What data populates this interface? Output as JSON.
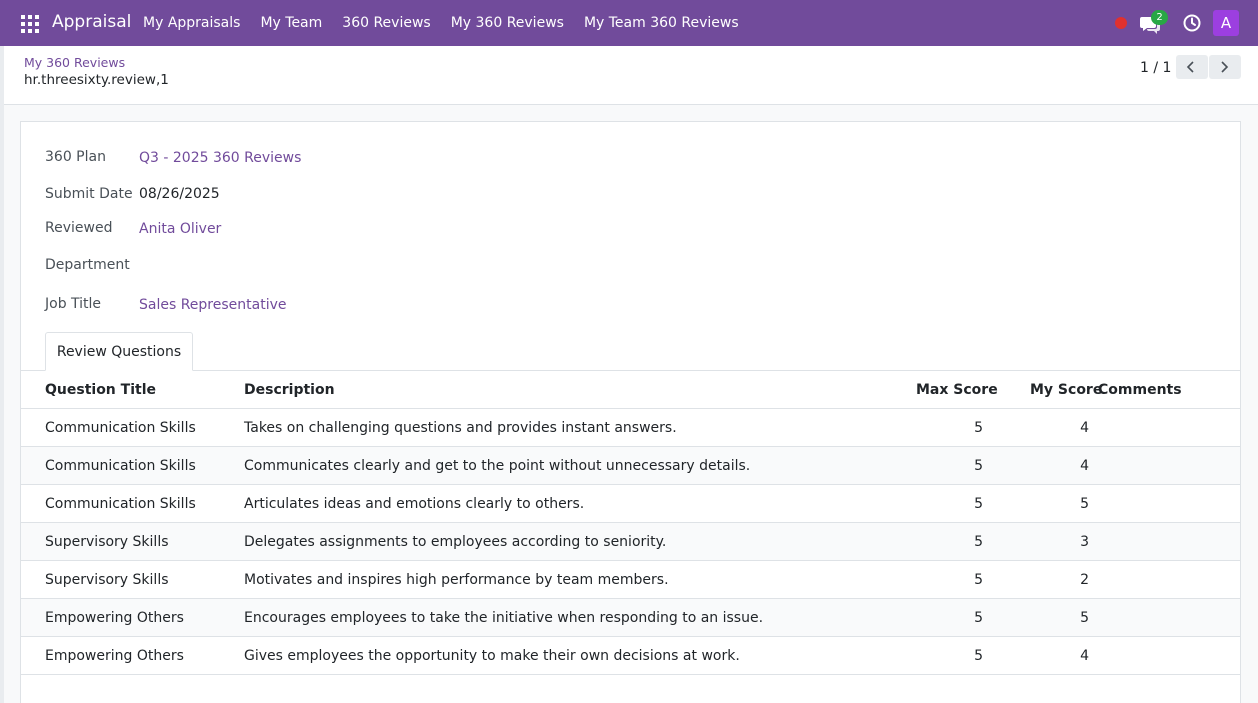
{
  "navbar": {
    "app_name": "Appraisal",
    "menu": [
      "My Appraisals",
      "My Team",
      "360 Reviews",
      "My 360 Reviews",
      "My Team 360 Reviews"
    ],
    "chat_badge": "2",
    "avatar_letter": "A",
    "icons": [
      "apps-grid-icon",
      "record-dot-icon",
      "chat-icon",
      "clock-icon"
    ]
  },
  "control_panel": {
    "breadcrumb": "My 360 Reviews",
    "record_name": "hr.threesixty.review,1",
    "pager": "1 / 1"
  },
  "form": {
    "plan_label": "360 Plan",
    "plan_value": "Q3 - 2025 360 Reviews",
    "submit_label": "Submit Date",
    "submit_value": "08/26/2025",
    "reviewed_label": "Reviewed",
    "reviewed_value": "Anita Oliver",
    "department_label": "Department",
    "department_value": "",
    "job_label": "Job Title",
    "job_value": "Sales Representative"
  },
  "tabs": [
    "Review Questions"
  ],
  "table": {
    "columns": [
      "Question Title",
      "Description",
      "Max Score",
      "My Score",
      "Comments"
    ],
    "rows": [
      {
        "title": "Communication Skills",
        "description": "Takes on challenging questions and provides instant answers.",
        "max_score": "5",
        "my_score": "4",
        "comments": ""
      },
      {
        "title": "Communication Skills",
        "description": "Communicates clearly and get to the point without unnecessary details.",
        "max_score": "5",
        "my_score": "4",
        "comments": ""
      },
      {
        "title": "Communication Skills",
        "description": "Articulates ideas and emotions clearly to others.",
        "max_score": "5",
        "my_score": "5",
        "comments": ""
      },
      {
        "title": "Supervisory Skills",
        "description": "Delegates assignments to employees according to seniority.",
        "max_score": "5",
        "my_score": "3",
        "comments": ""
      },
      {
        "title": "Supervisory Skills",
        "description": "Motivates and inspires high performance by team members.",
        "max_score": "5",
        "my_score": "2",
        "comments": ""
      },
      {
        "title": "Empowering Others",
        "description": "Encourages employees to take the initiative when responding to an issue.",
        "max_score": "5",
        "my_score": "5",
        "comments": ""
      },
      {
        "title": "Empowering Others",
        "description": "Gives employees the opportunity to make their own decisions at work.",
        "max_score": "5",
        "my_score": "4",
        "comments": ""
      }
    ]
  },
  "colors": {
    "navbar": "#714b9b",
    "link": "#714b9b",
    "badge": "#28a745",
    "avatar": "#9c3fe0",
    "record_dot": "#e0312f"
  }
}
